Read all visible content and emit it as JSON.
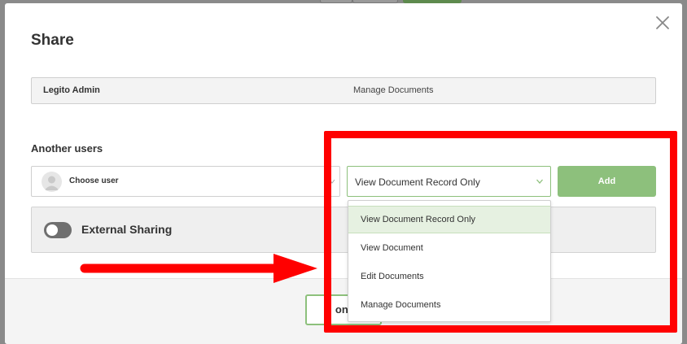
{
  "dialog": {
    "title": "Share",
    "close_icon": "close-icon"
  },
  "owner": {
    "name": "Legito Admin",
    "permission": "Manage Documents"
  },
  "another_users": {
    "label": "Another users",
    "user_select_placeholder": "Choose user",
    "permission_select_value": "View Document Record Only",
    "add_label": "Add"
  },
  "external_sharing": {
    "label": "External Sharing",
    "enabled": false
  },
  "permission_options": [
    {
      "label": "View Document Record Only",
      "selected": true
    },
    {
      "label": "View Document",
      "selected": false
    },
    {
      "label": "Edit Documents",
      "selected": false
    },
    {
      "label": "Manage Documents",
      "selected": false
    }
  ],
  "footer": {
    "confirm_label_visible": "onf"
  },
  "annotation": {
    "highlight_color": "#ff0000",
    "arrow_color": "#ff0000"
  },
  "colors": {
    "accent_green": "#8dc07c",
    "selected_bg": "#e6f1e1",
    "overlay_backdrop": "#8a8a8a"
  }
}
